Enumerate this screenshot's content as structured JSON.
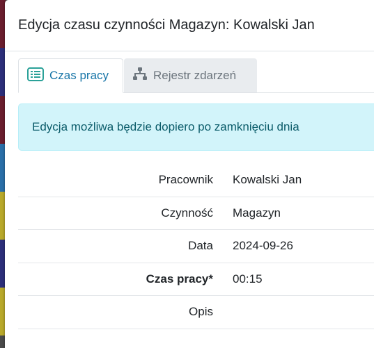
{
  "colors": {
    "accent": "#1976a8",
    "alert_bg": "#d2f4fa",
    "alert_text": "#0b5c6a",
    "backdrop_stripes": [
      "#6b1e2e",
      "#2c2f7a",
      "#6b1e2e",
      "#2a6fa8",
      "#b9a92a",
      "#2c2f7a",
      "#b9a92a",
      "#3a3a3a"
    ]
  },
  "modal": {
    "title": "Edycja czasu czynności Magazyn: Kowalski Jan"
  },
  "tabs": [
    {
      "label": "Czas pracy",
      "icon": "list-icon",
      "active": true
    },
    {
      "label": "Rejestr zdarzeń",
      "icon": "sitemap-icon",
      "active": false
    }
  ],
  "alert": {
    "text": "Edycja możliwa będzie dopiero po zamknięciu dnia"
  },
  "details": [
    {
      "label": "Pracownik",
      "value": "Kowalski Jan",
      "required": false
    },
    {
      "label": "Czynność",
      "value": "Magazyn",
      "required": false
    },
    {
      "label": "Data",
      "value": "2024-09-26",
      "required": false
    },
    {
      "label": "Czas pracy*",
      "value": "00:15",
      "required": true
    },
    {
      "label": "Opis",
      "value": "",
      "required": false
    }
  ]
}
